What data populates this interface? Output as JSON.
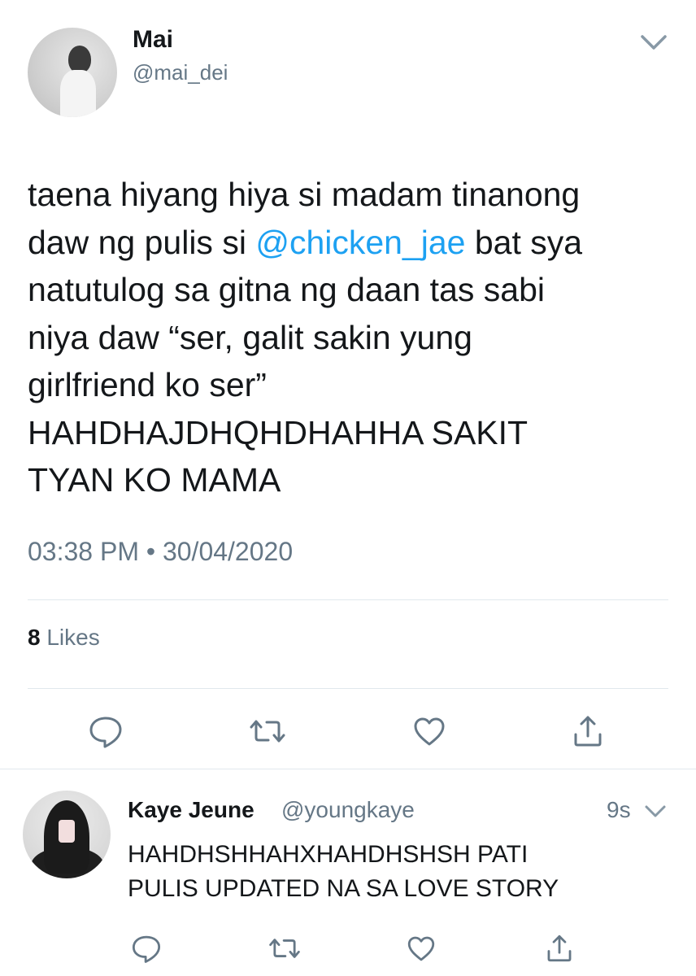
{
  "tweet": {
    "author": {
      "display_name": "Mai",
      "handle": "@mai_dei"
    },
    "text_lines": [
      {
        "before": "taena hiyang hiya si madam tinanong",
        "mention": "",
        "after": ""
      },
      {
        "before": "daw ng pulis si ",
        "mention": "@chicken_jae",
        "after": " bat sya"
      },
      {
        "before": "natutulog sa gitna ng daan tas sabi",
        "mention": "",
        "after": ""
      },
      {
        "before": "niya daw “ser, galit sakin yung",
        "mention": "",
        "after": ""
      },
      {
        "before": "girlfriend ko ser”",
        "mention": "",
        "after": ""
      },
      {
        "before": "HAHDHAJDHQHDHAHHA SAKIT",
        "mention": "",
        "after": ""
      },
      {
        "before": "TYAN KO MAMA",
        "mention": "",
        "after": ""
      }
    ],
    "timestamp": "03:38 PM • 30/04/2020",
    "likes_count": "8",
    "likes_label": "Likes",
    "actions": [
      "reply-icon",
      "retweet-icon",
      "like-icon",
      "share-icon"
    ]
  },
  "reply": {
    "display_name": "Kaye Jeune",
    "handle": "@youngkaye",
    "time": "9s",
    "text_lines": [
      "HAHDHSHHAHXHAHDHSHSH PATI",
      "PULIS UPDATED NA SA LOVE STORY"
    ],
    "actions": [
      "reply-icon",
      "retweet-icon",
      "like-icon",
      "share-icon"
    ]
  },
  "colors": {
    "link": "#1da1f2",
    "secondary_text": "#657786",
    "primary_text": "#14171a",
    "divider": "#e1e8ed"
  }
}
